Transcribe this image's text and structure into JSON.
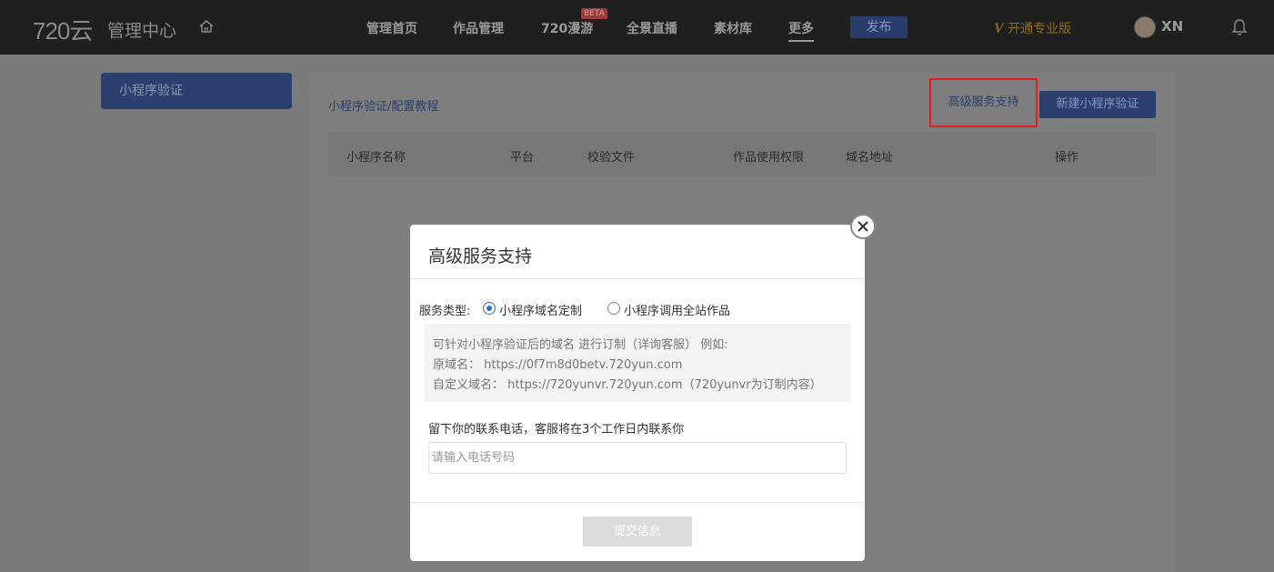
{
  "header": {
    "logo": "720云",
    "subtitle": "管理中心",
    "nav": [
      "管理首页",
      "作品管理",
      "720漫游",
      "全景直播",
      "素材库",
      "更多"
    ],
    "beta": "BETA",
    "publish": "发布",
    "vip_mark": "V",
    "vip_label": "开通专业版",
    "username": "XN"
  },
  "sidebar": {
    "item": "小程序验证"
  },
  "main": {
    "breadcrumb": "小程序验证/配置教程",
    "advanced_button": "高级服务支持",
    "new_button": "新建小程序验证",
    "columns": [
      "小程序名称",
      "平台",
      "校验文件",
      "作品使用权限",
      "域名地址",
      "操作"
    ]
  },
  "modal": {
    "title": "高级服务支持",
    "service_type_label": "服务类型:",
    "options": [
      "小程序域名定制",
      "小程序调用全站作品"
    ],
    "selected_option": "小程序域名定制",
    "info": [
      "可针对小程序验证后的域名 进行订制（详询客服） 例如:",
      "原域名： https://0f7m8d0betv.720yun.com",
      "自定义域名： https://720yunvr.720yun.com（720yunvr为订制内容）"
    ],
    "phone_label": "留下你的联系电话，客服将在3个工作日内联系你",
    "phone_placeholder": "请输入电话号码",
    "phone_value": "",
    "submit": "提交信息"
  },
  "colors": {
    "accent": "#2f6fdc",
    "highlight": "#e02020",
    "vip": "#8e6c1e"
  },
  "icons": [
    "home-icon",
    "bell-icon",
    "close-icon"
  ]
}
